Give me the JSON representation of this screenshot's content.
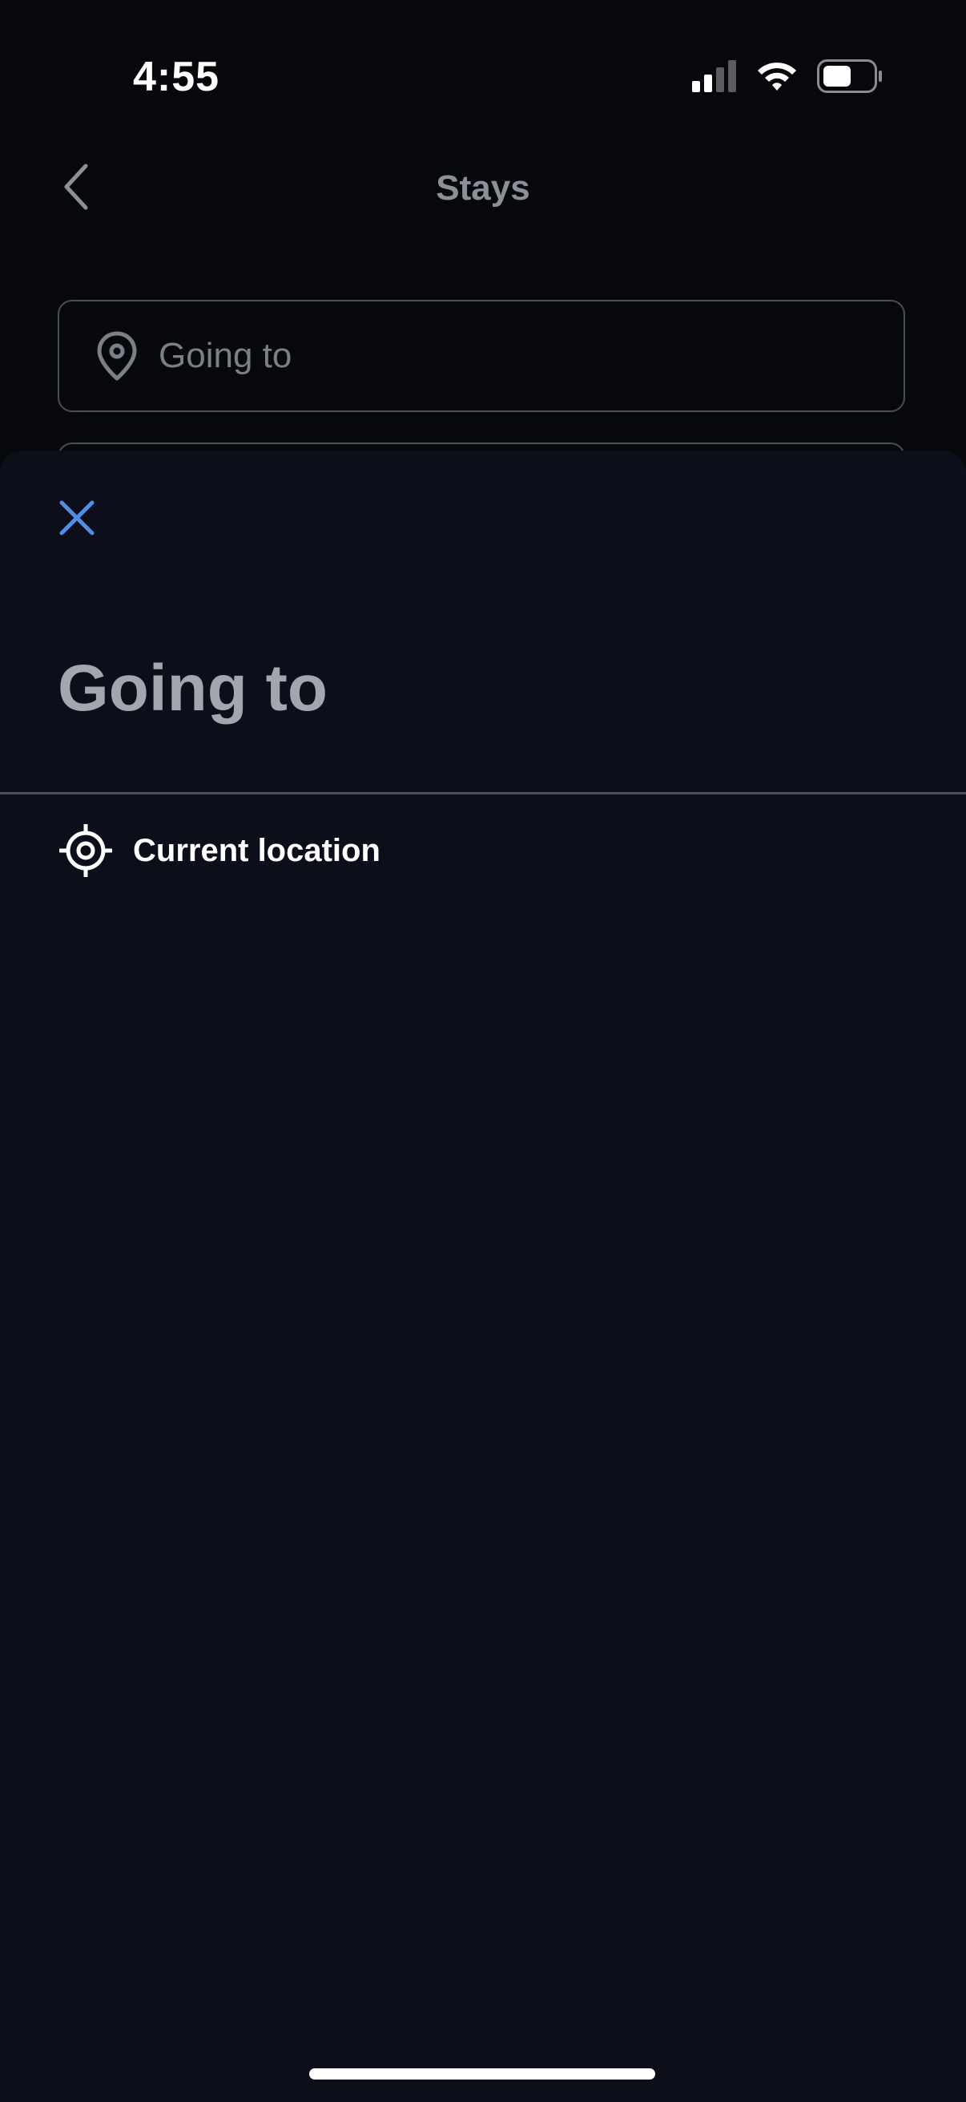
{
  "status_bar": {
    "time": "4:55",
    "icons": [
      "cellular-signal-icon",
      "wifi-icon",
      "battery-icon"
    ]
  },
  "nav": {
    "back_icon": "chevron-left-icon",
    "title": "Stays"
  },
  "search": {
    "icon": "location-pin-icon",
    "placeholder": "Going to"
  },
  "sheet": {
    "close_icon": "close-icon",
    "title": "Going to",
    "options": [
      {
        "icon": "crosshair-target-icon",
        "label": "Current location"
      }
    ]
  },
  "colors": {
    "background": "#07080c",
    "sheet": "#0c0e1a",
    "accent": "#4f8fe8",
    "muted_text": "#8c8f98"
  }
}
